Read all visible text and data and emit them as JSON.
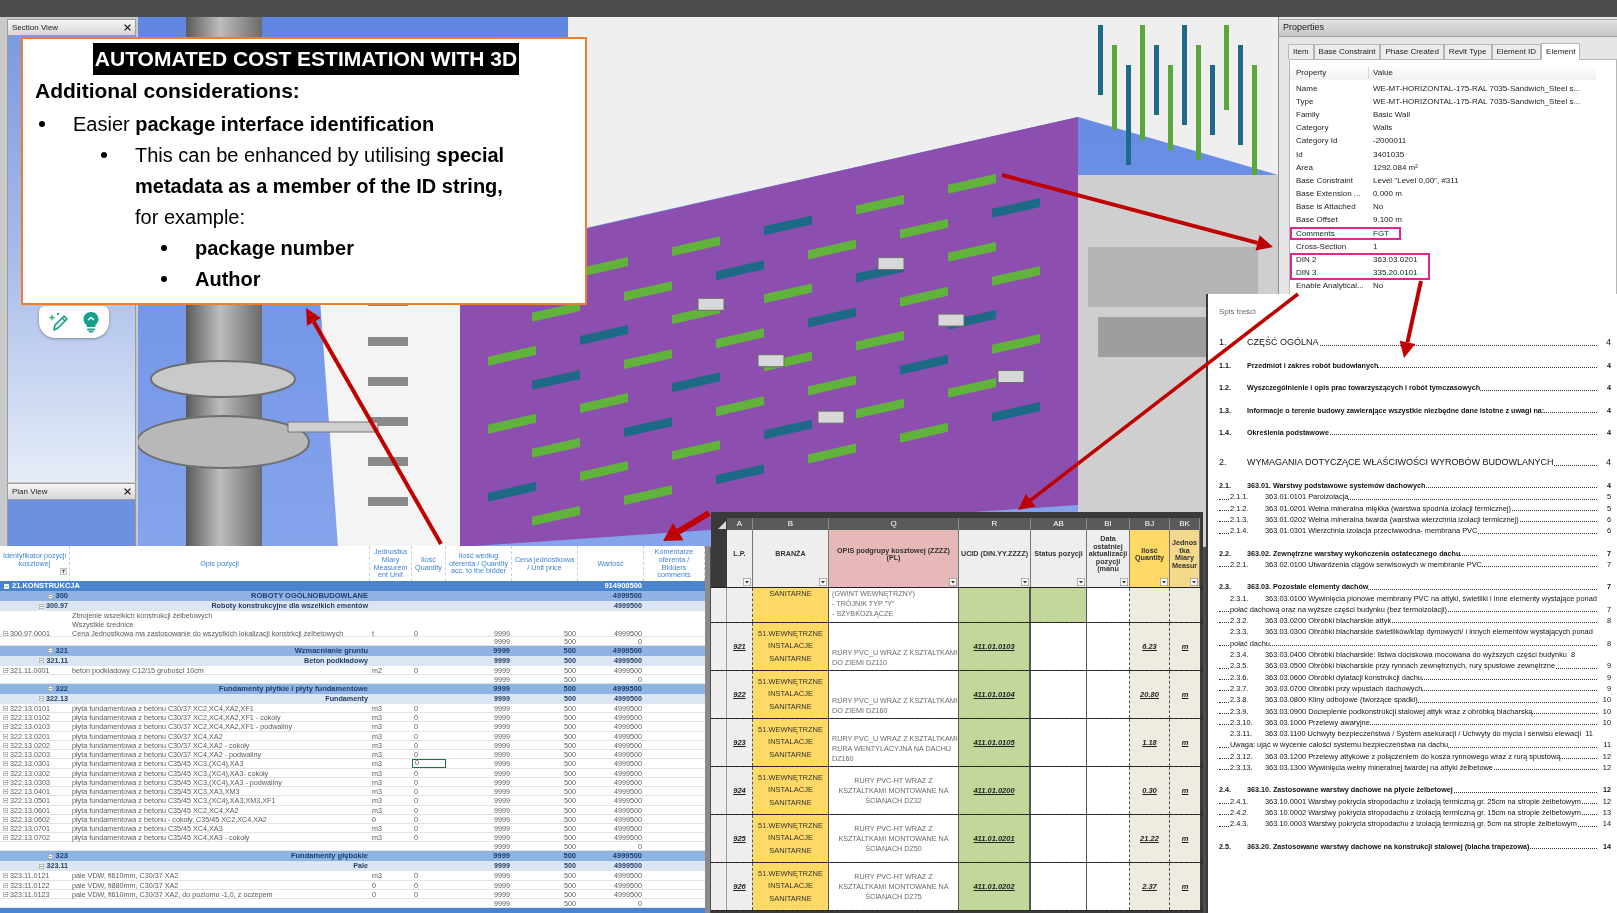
{
  "left_dock": {
    "section_view": {
      "title": "Section View"
    },
    "plan_view": {
      "title": "Plan View"
    }
  },
  "callout": {
    "title": "AUTOMATED COST ESTIMATION WITH 3D",
    "heading": "Additional considerations:",
    "bullets": [
      {
        "text": "Easier **package interface identification**",
        "children": [
          {
            "text": "This can be enhanced by utilising **special metadata as a member of the ID string,** for example:",
            "children": [
              {
                "text": "package number"
              },
              {
                "text": "Author"
              }
            ]
          }
        ]
      }
    ]
  },
  "properties": {
    "title": "Properties",
    "tabs": [
      {
        "label": "Item",
        "selected": false
      },
      {
        "label": "Base Constraint",
        "selected": false
      },
      {
        "label": "Phase Created",
        "selected": false
      },
      {
        "label": "Revit Type",
        "selected": false
      },
      {
        "label": "Element ID",
        "selected": false
      },
      {
        "label": "Element",
        "selected": true
      }
    ],
    "columns": [
      "Property",
      "Value"
    ],
    "rows": [
      {
        "property": "Name",
        "value": "WE-MT-HORIZONTAL-175-RAL 7035-Sandwich_Steel s...",
        "highlighted": false
      },
      {
        "property": "Type",
        "value": "WE-MT-HORIZONTAL-175-RAL 7035-Sandwich_Steel s...",
        "highlighted": false
      },
      {
        "property": "Family",
        "value": "Basic Wall",
        "highlighted": false
      },
      {
        "property": "Category",
        "value": "Walls",
        "highlighted": false
      },
      {
        "property": "Category Id",
        "value": "-2000011",
        "highlighted": false
      },
      {
        "property": "Id",
        "value": "3401035",
        "highlighted": false
      },
      {
        "property": "Area",
        "value": "1292.084 m²",
        "highlighted": false
      },
      {
        "property": "Base Constraint",
        "value": "Level \"Level 0,00\", #311",
        "highlighted": false
      },
      {
        "property": "Base Extension ...",
        "value": "0.000 m",
        "highlighted": false
      },
      {
        "property": "Base is Attached",
        "value": "No",
        "highlighted": false
      },
      {
        "property": "Base Offset",
        "value": "9.100 m",
        "highlighted": false
      },
      {
        "property": "Comments",
        "value": "FGT",
        "highlighted": true
      },
      {
        "property": "Cross-Section",
        "value": "1",
        "highlighted": false
      },
      {
        "property": "DIN 2",
        "value": "363.03.0201",
        "highlighted": true
      },
      {
        "property": "DIN 3",
        "value": "335.20.0101",
        "highlighted": true
      },
      {
        "property": "Enable Analytical...",
        "value": "No",
        "highlighted": false
      }
    ]
  },
  "sheet_left": {
    "columns": [
      "Identyfikator pozycji kosztowej",
      "Opis pozycji",
      "Jednostka Miary Measurement Unit",
      "Ilość Quantity",
      "Ilość według oferenta / Quantity acc. to the bidder",
      "Cena jednostkowa / Unit price",
      "Wartość",
      "Komentarze oferenta / Bidders comments"
    ],
    "rows": [
      {
        "kind": "level1",
        "id": "21.KONSTRUKCJA",
        "value": "914908500"
      },
      {
        "kind": "level2",
        "id": "300",
        "description": "ROBOTY OGÓLNOBUDOWLANE",
        "value": "4999500"
      },
      {
        "kind": "level3",
        "id": "300.97",
        "description": "Roboty konstrukcyjne dla wszelkich ementów",
        "value": "4999500"
      },
      {
        "kind": "item",
        "id": "300.97.0001",
        "description": "Zbrojenie wszelkich konstrukcji żelbetowych\nWszystkie średnice\nCena Jednostkowa ma zastosowanie do wszystkich lokalizacji konstrkcji żelbetowych",
        "unit": "t",
        "quantity": "0",
        "bid_quantity": "9999",
        "price": "500",
        "value": "4999500",
        "selected": false
      },
      {
        "kind": "subtotal",
        "bid_quantity": "9999",
        "price": "500",
        "value": "0"
      },
      {
        "kind": "level2",
        "id": "321",
        "description": "Wzmacnianie gruntu",
        "bid_quantity": "9999",
        "price": "500",
        "value": "4999500"
      },
      {
        "kind": "level3",
        "id": "321.11",
        "description": "Beton podkładowy",
        "bid_quantity": "9999",
        "price": "500",
        "value": "4999500"
      },
      {
        "kind": "item",
        "id": "321.11.0001",
        "description": "beton podkładowy C12/15 grubości 10cm",
        "unit": "m2",
        "quantity": "0",
        "bid_quantity": "9999",
        "price": "500",
        "value": "4999500",
        "selected": false
      },
      {
        "kind": "subtotal",
        "bid_quantity": "9999",
        "price": "500",
        "value": "0"
      },
      {
        "kind": "level2",
        "id": "322",
        "description": "Fundamenty płytkie i płyty fundamentowe",
        "bid_quantity": "9999",
        "price": "500",
        "value": "4999500"
      },
      {
        "kind": "level3",
        "id": "322.13",
        "description": "Fundamenty",
        "bid_quantity": "9999",
        "price": "500",
        "value": "4999500"
      },
      {
        "kind": "item",
        "id": "322.13.0101",
        "description": "płyta fundamentowa z betonu C30/37 XC2,XC4,XA2,XF1",
        "unit": "m3",
        "quantity": "0",
        "bid_quantity": "9999",
        "price": "500",
        "value": "4999500",
        "selected": false
      },
      {
        "kind": "item",
        "id": "322.13.0102",
        "description": "płyta fundamentowa z betonu C30/37 XC2,XC4,XA2,XF1 - cokoły",
        "unit": "m3",
        "quantity": "0",
        "bid_quantity": "9999",
        "price": "500",
        "value": "4999500",
        "selected": false
      },
      {
        "kind": "item",
        "id": "322.13.0103",
        "description": "płyta fundamentowa z betonu C30/37 XC2,XC4,XA2,XF1 - podwaliny",
        "unit": "m3",
        "quantity": "0",
        "bid_quantity": "9999",
        "price": "500",
        "value": "4999500",
        "selected": false
      },
      {
        "kind": "item",
        "id": "322.13.0201",
        "description": "płyta fundamentowa z betonu C30/37 XC4,XA2",
        "unit": "m3",
        "quantity": "0",
        "bid_quantity": "9999",
        "price": "500",
        "value": "4999500",
        "selected": false
      },
      {
        "kind": "item",
        "id": "322.13.0202",
        "description": "płyta fundamentowa z betonu C30/37 XC4,XA2 - cokoły",
        "unit": "m3",
        "quantity": "0",
        "bid_quantity": "9999",
        "price": "500",
        "value": "4999500",
        "selected": false
      },
      {
        "kind": "item",
        "id": "322.13.0203",
        "description": "płyta fundamentowa z betonu C30/37 XC4,XA2 - podwaliny",
        "unit": "m3",
        "quantity": "0",
        "bid_quantity": "9999",
        "price": "500",
        "value": "4999500",
        "selected": false
      },
      {
        "kind": "item",
        "id": "322.13.0301",
        "description": "płyta fundamentowa z betonu C35/45 XC3,(XC4),XA3",
        "unit": "m3",
        "quantity": "0",
        "bid_quantity": "9999",
        "price": "500",
        "value": "4999500",
        "selected": true
      },
      {
        "kind": "item",
        "id": "322.13.0302",
        "description": "płyta fundamentowa z betonu C35/45 XC3,(XC4),XA3- cokoły",
        "unit": "m3",
        "quantity": "0",
        "bid_quantity": "9999",
        "price": "500",
        "value": "4999500",
        "selected": false
      },
      {
        "kind": "item",
        "id": "322.13.0303",
        "description": "płyta fundamentowa z betonu C35/45 XC3,(XC4),XA3 - podwaliny",
        "unit": "m3",
        "quantity": "0",
        "bid_quantity": "9999",
        "price": "500",
        "value": "4999500",
        "selected": false
      },
      {
        "kind": "item",
        "id": "322.13.0401",
        "description": "płyta fundamentowa z betonu C35/45 XC3,XA3,XM3",
        "unit": "m3",
        "quantity": "0",
        "bid_quantity": "9999",
        "price": "500",
        "value": "4999500",
        "selected": false
      },
      {
        "kind": "item",
        "id": "322.13.0501",
        "description": "płyta fundamentowa z betonu C35/45 XC3,(XC4),XA3,XM3,XF1",
        "unit": "m3",
        "quantity": "0",
        "bid_quantity": "9999",
        "price": "500",
        "value": "4999500",
        "selected": false
      },
      {
        "kind": "item",
        "id": "322.13.0601",
        "description": "płyta fundamentowa z betonu C35/45 XC2,XC4,XA2",
        "unit": "m3",
        "quantity": "0",
        "bid_quantity": "9999",
        "price": "500",
        "value": "4999500",
        "selected": false
      },
      {
        "kind": "item",
        "id": "322.13.0602",
        "description": "płyta fundamentowa z betonu - cokoły, C35/45 XC2,XC4,XA2",
        "unit": "0",
        "quantity": "0",
        "bid_quantity": "9999",
        "price": "500",
        "value": "4999500",
        "selected": false
      },
      {
        "kind": "item",
        "id": "322.13.0701",
        "description": "płyta fundamentowa z betonu C35/45 XC4,XA3",
        "unit": "m3",
        "quantity": "0",
        "bid_quantity": "9999",
        "price": "500",
        "value": "4999500",
        "selected": false
      },
      {
        "kind": "item",
        "id": "322.13.0702",
        "description": "płyta fundamentowa z betonu C35/45 XC4,XA3 - cokoły",
        "unit": "m3",
        "quantity": "0",
        "bid_quantity": "9999",
        "price": "500",
        "value": "4999500",
        "selected": false
      },
      {
        "kind": "subtotal",
        "bid_quantity": "9999",
        "price": "500",
        "value": "0"
      },
      {
        "kind": "level2",
        "id": "323",
        "description": "Fundamenty głębokie",
        "bid_quantity": "9999",
        "price": "500",
        "value": "4999500"
      },
      {
        "kind": "level3",
        "id": "323.11",
        "description": "Pale",
        "bid_quantity": "9999",
        "price": "500",
        "value": "4999500"
      },
      {
        "kind": "item",
        "id": "323.11.0121",
        "description": "pale VDW, fi610mm, C30/37 XA2",
        "unit": "m3",
        "quantity": "0",
        "bid_quantity": "9999",
        "price": "500",
        "value": "4999500",
        "selected": false
      },
      {
        "kind": "item",
        "id": "323.11.0122",
        "description": "pale VDW, fi880mm, C30/37 XA2",
        "unit": "0",
        "quantity": "0",
        "bid_quantity": "9999",
        "price": "500",
        "value": "4999500",
        "selected": false
      },
      {
        "kind": "item",
        "id": "323.11.0123",
        "description": "pale VDW, fi610mm, C30/37 XA2, do poziomu -1,0, z oczepem",
        "unit": "0",
        "quantity": "0",
        "bid_quantity": "9999",
        "price": "500",
        "value": "4999500",
        "selected": false
      },
      {
        "kind": "subtotal",
        "bid_quantity": "9999",
        "price": "500",
        "value": "0"
      }
    ]
  },
  "sheet_middle": {
    "column_letters": [
      "A",
      "B",
      "Q",
      "R",
      "AB",
      "BI",
      "BJ",
      "BK"
    ],
    "headers": [
      {
        "label": "L.P.",
        "color": "#eeeeee"
      },
      {
        "label": "BRANŻA",
        "color": "#eeeeee"
      },
      {
        "label": "OPIS podgrupy kosztowej (ZZZZ) (PL)",
        "color": "#e6b8b7"
      },
      {
        "label": "UCID (DIN.YY.ZZZZ)",
        "color": "#eeeeee"
      },
      {
        "label": "Status pozycji",
        "color": "#eeeeee"
      },
      {
        "label": "Data ostatniej aktualizacji pozycji (manu",
        "color": "#eeeeee"
      },
      {
        "label": "Ilość Quantity",
        "color": "#ffd966"
      },
      {
        "label": "Jednostka Miary Measur",
        "color": "#f4d98c"
      }
    ],
    "rows": [
      {
        "kind": "continued",
        "branch": "SANITARNE",
        "description": "(GWINT WEWNĘTRZNY)\n- TRÓJNIK TYP \"Y\"\n- SZYBKOZŁĄCZE",
        "status_filled": true
      },
      {
        "kind": "item",
        "lp": "921",
        "branch": "51.WEWNĘTRZNE INSTALACJE SANITARNE",
        "description": "RURY PVC_U WRAZ Z KSZTALTKAMI DO ZIEMI DZ110",
        "description_centered": false,
        "ucid": "411.01.0103",
        "status_filled": false,
        "quantity": "6.23",
        "unit": "m"
      },
      {
        "kind": "item",
        "lp": "922",
        "branch": "51.WEWNĘTRZNE INSTALACJE SANITARNE",
        "description": "RURY PVC_U WRAZ Z KSZTALTKAMI DO ZIEMI DZ160",
        "description_centered": false,
        "ucid": "411.01.0104",
        "status_filled": false,
        "quantity": "20.80",
        "unit": "m"
      },
      {
        "kind": "item",
        "lp": "923",
        "branch": "51.WEWNĘTRZNE INSTALACJE SANITARNE",
        "description": "RURY PVC_U WRAZ Z KSZTALTKAMI RURA WENTYLACYJNA NA DACHU DZ160",
        "description_centered": false,
        "ucid": "411.01.0105",
        "status_filled": false,
        "quantity": "1.18",
        "unit": "m"
      },
      {
        "kind": "item",
        "lp": "924",
        "branch": "51.WEWNĘTRZNE INSTALACJE SANITARNE",
        "description": "RURY PVC-HT WRAZ Z KSZTALTKAMI MONTOWANE NA ŚCIANACH DZ32",
        "description_centered": true,
        "ucid": "411.01.0200",
        "status_filled": false,
        "quantity": "0.30",
        "unit": "m"
      },
      {
        "kind": "item",
        "lp": "925",
        "branch": "51.WEWNĘTRZNE INSTALACJE SANITARNE",
        "description": "RURY PVC-HT WRAZ Z KSZTALTKAMI MONTOWANE NA ŚCIANACH DZ50",
        "description_centered": true,
        "ucid": "411.01.0201",
        "status_filled": false,
        "quantity": "21.22",
        "unit": "m"
      },
      {
        "kind": "item",
        "lp": "926",
        "branch": "51.WEWNĘTRZNE INSTALACJE SANITARNE",
        "description": "RURY PVC-HT WRAZ Z KSZTALTKAMI MONTOWANE NA ŚCIANACH DZ75",
        "description_centered": true,
        "ucid": "411.01.0202",
        "status_filled": false,
        "quantity": "2.37",
        "unit": "m"
      }
    ]
  },
  "document": {
    "title": "Spis treści",
    "entries": [
      {
        "kind": "chapter",
        "number": "1.",
        "title": "CZĘŚĆ OGÓLNA",
        "page": "4"
      },
      {
        "kind": "section",
        "number": "1.1.",
        "title": "Przedmiot i zakres robót budowlanych",
        "page": "4"
      },
      {
        "kind": "section",
        "number": "1.2.",
        "title": "Wyszczególnienie i opis prac towarzyszących i robót tymczasowych",
        "page": "4"
      },
      {
        "kind": "section",
        "number": "1.3.",
        "title": "Informacje o terenie budowy zawierające wszystkie niezbędne dane istotne z uwagi na:",
        "page": "4"
      },
      {
        "kind": "section",
        "number": "1.4.",
        "title": "Określenia podstawowe",
        "page": "4"
      },
      {
        "kind": "chapter",
        "number": "2.",
        "title": "WYMAGANIA DOTYCZĄCE WŁAŚCIWOŚCI WYROBÓW BUDOWLANYCH",
        "page": "4"
      },
      {
        "kind": "section",
        "number": "2.1.",
        "title": "363.01. Warstwy podstawowe systemów dachowych",
        "page": "4"
      },
      {
        "kind": "subsection",
        "number": "2.1.1.",
        "title": "363.01.0101 Paroizolacja",
        "page": "5"
      },
      {
        "kind": "subsection",
        "number": "2.1.2.",
        "title": "363.01.0201 Wełna mineralna miękka (warstwa spodnia izolacji termicznej)",
        "page": "5"
      },
      {
        "kind": "subsection",
        "number": "2.1.3.",
        "title": "363.01.0202 Wełna mineralna twarda (warstwa wierzchnia izolacji termicznej)",
        "page": "6"
      },
      {
        "kind": "subsection",
        "number": "2.1.4.",
        "title": "363.01.0301 Wierzchnia izolacja przeciwwodna- membrana PVC",
        "page": "6"
      },
      {
        "kind": "section",
        "number": "2.2.",
        "title": "363.02. Zewnętrzne warstwy wykończenia ostatecznego dachu",
        "page": "7"
      },
      {
        "kind": "subsection",
        "number": "2.2.1.",
        "title": "363.02.0100 Utwardzenia ciągów serwisowych w membranie PVC",
        "page": "7"
      },
      {
        "kind": "section",
        "number": "2.3.",
        "title": "363.03. Pozostałe elementy dachów",
        "page": "7"
      },
      {
        "kind": "subsection",
        "number": "2.3.1.",
        "title": "363.03.0100 Wywinięcia pionowe membrany PVC na attyki, świetliki i inne elementy wystające ponad połać dachową oraz na wyższe części budynku (bez termoizolacji)",
        "page": "7"
      },
      {
        "kind": "subsection",
        "number": "2.3.2.",
        "title": "363.03.0200 Obróbki blacharskie attyk",
        "page": "8"
      },
      {
        "kind": "subsection",
        "number": "2.3.3.",
        "title": "363.03.0300 Obróbki blacharskie świetlików/klap dymowych/ i innych elementów wystających ponad połać dachu",
        "page": "8"
      },
      {
        "kind": "runin",
        "number": "2.3.4.",
        "title": "363.03.0400 Obróbki blacharskie: listwa dociskowa mocowana do wyższych części budynku",
        "page": "8"
      },
      {
        "kind": "subsection",
        "number": "2.3.5.",
        "title": "363.03.0500 Obróbki blacharskie przy rynnach zewnętrznych, rury spustowe zewnętrzne",
        "page": "9"
      },
      {
        "kind": "subsection",
        "number": "2.3.6.",
        "title": "363.03.0600 Obróbki dylatacji konstrukcji dachu",
        "page": "9"
      },
      {
        "kind": "subsection",
        "number": "2.3.7.",
        "title": "363.03.0700 Obróbki przy wpustach dachowych",
        "page": "9"
      },
      {
        "kind": "subsection",
        "number": "2.3.8.",
        "title": "363.03.0800 Kliny odbojowe (tworzące spadki)",
        "page": "10"
      },
      {
        "kind": "subsection",
        "number": "2.3.9.",
        "title": "363.03.0900 Docieplenie podkonstrukcji stalowej attyk wraz z obróbką blacharską",
        "page": "10"
      },
      {
        "kind": "subsection",
        "number": "2.3.10.",
        "title": "363.03.1000 Przelewy awaryjne",
        "page": "10"
      },
      {
        "kind": "runin",
        "number": "2.3.11.",
        "title": "363.03.1100 Uchwyty bezpieczeństwa / System asekuracji / Uchwyty do mycia i serwisu elewacji",
        "page": "11"
      },
      {
        "kind": "note",
        "title": "Uwaga: ująć w wycenie całości systemu bezpieczeństwa na dachu",
        "page": "11"
      },
      {
        "kind": "subsection",
        "number": "2.3.12.",
        "title": "363.03.1200 Przelewy attykowe z połączeniem do kosza rynnowego wraz z rurą spustową",
        "page": "12"
      },
      {
        "kind": "subsection",
        "number": "2.3.13.",
        "title": "363.03.1300 Wywinięcia wełny mineralnej twardej na attyki żelbetowe",
        "page": "12"
      },
      {
        "kind": "section",
        "number": "2.4.",
        "title": "363.10. Zastosowane warstwy dachowe na płycie żelbetowej",
        "page": "12"
      },
      {
        "kind": "subsection",
        "number": "2.4.1.",
        "title": "363.10.0001 Warstwy pokrycia stropodachu z izolacją termiczną gr. 25cm na stropie żelbetowym",
        "page": "12"
      },
      {
        "kind": "subsection",
        "number": "2.4.2.",
        "title": "363.10.0002 Warstwy pokrycia stropodachu z izolacją termiczną gr. 15cm na stropie żelbetowym",
        "page": "13"
      },
      {
        "kind": "subsection",
        "number": "2.4.3.",
        "title": "363.10.0003 Warstwy pokrycia stropodachu z izolacją termiczną gr. 5cm na stropie żelbetowym",
        "page": "14"
      },
      {
        "kind": "section",
        "number": "2.5.",
        "title": "363.20. Zastosowane warstwy dachowe na konstrukcji stalowej (blacha trapezowa)",
        "page": "14"
      }
    ]
  }
}
